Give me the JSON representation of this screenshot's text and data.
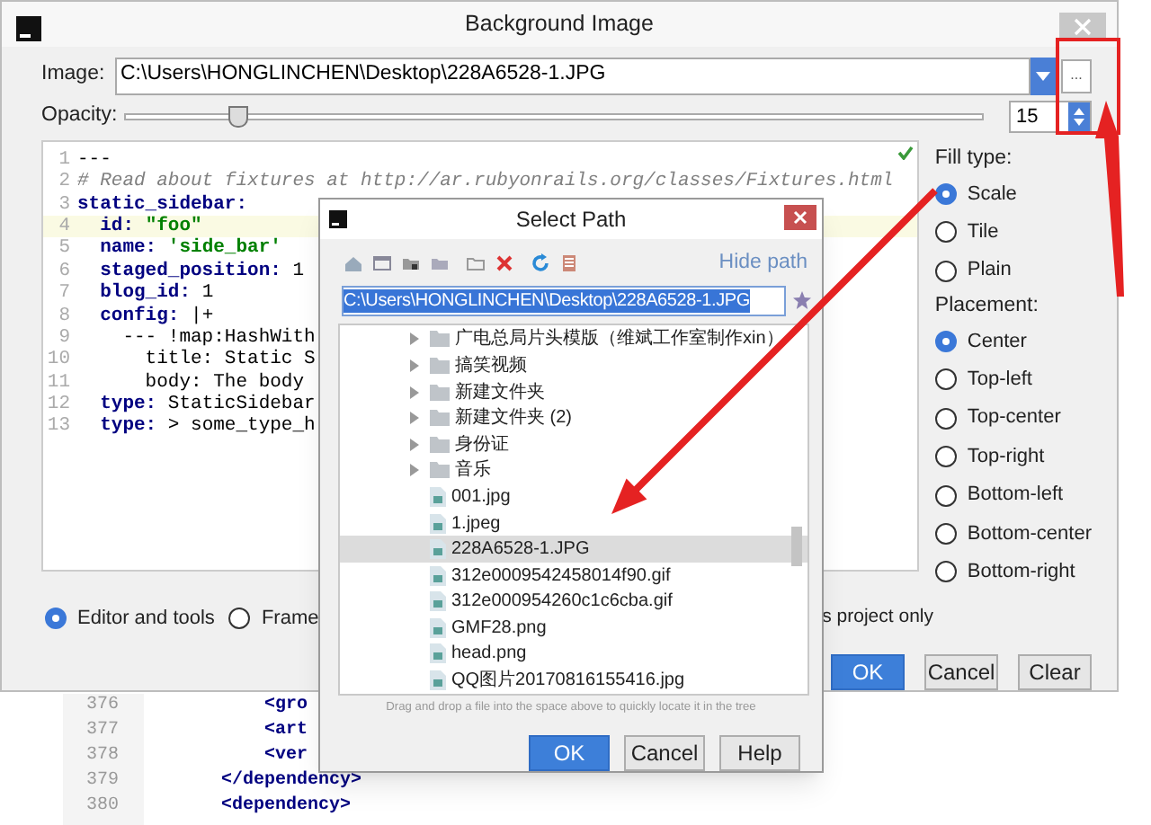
{
  "window": {
    "title": "Background Image"
  },
  "image_field": {
    "label": "Image:",
    "value": "C:\\Users\\HONGLINCHEN\\Desktop\\228A6528-1.JPG",
    "browse": "..."
  },
  "opacity": {
    "label": "Opacity:",
    "level": 0.13,
    "value": "15"
  },
  "preview_lines": [
    {
      "number": "1",
      "current": false,
      "tokens": [
        {
          "text": "---",
          "kind": "plain"
        }
      ]
    },
    {
      "number": "2",
      "current": false,
      "tokens": [
        {
          "text": "# Read about fixtures at http://ar.rubyonrails.org/classes/Fixtures.html",
          "kind": "comment"
        }
      ]
    },
    {
      "number": "3",
      "current": false,
      "tokens": [
        {
          "text": "static_sidebar:",
          "kind": "key"
        }
      ]
    },
    {
      "number": "4",
      "current": true,
      "tokens": [
        {
          "text": "  id:",
          "kind": "key"
        },
        {
          "text": " \"foo\"",
          "kind": "string"
        }
      ]
    },
    {
      "number": "5",
      "current": false,
      "tokens": [
        {
          "text": "  name:",
          "kind": "key"
        },
        {
          "text": " 'side_bar'",
          "kind": "string"
        }
      ]
    },
    {
      "number": "6",
      "current": false,
      "tokens": [
        {
          "text": "  staged_position:",
          "kind": "key"
        },
        {
          "text": " 1",
          "kind": "plain"
        }
      ]
    },
    {
      "number": "7",
      "current": false,
      "tokens": [
        {
          "text": "  blog_id:",
          "kind": "key"
        },
        {
          "text": " 1",
          "kind": "plain"
        }
      ]
    },
    {
      "number": "8",
      "current": false,
      "tokens": [
        {
          "text": "  config:",
          "kind": "key"
        },
        {
          "text": " |+",
          "kind": "plain"
        }
      ]
    },
    {
      "number": "9",
      "current": false,
      "tokens": [
        {
          "text": "    --- !map:HashWith",
          "kind": "plain"
        }
      ]
    },
    {
      "number": "10",
      "current": false,
      "tokens": [
        {
          "text": "      title: Static S",
          "kind": "plain"
        }
      ]
    },
    {
      "number": "11",
      "current": false,
      "tokens": [
        {
          "text": "      body: The body",
          "kind": "plain"
        }
      ]
    },
    {
      "number": "12",
      "current": false,
      "tokens": [
        {
          "text": "  type:",
          "kind": "key"
        },
        {
          "text": " StaticSidebar",
          "kind": "plain"
        }
      ]
    },
    {
      "number": "13",
      "current": false,
      "tokens": [
        {
          "text": "  type:",
          "kind": "key"
        },
        {
          "text": " > some_type_h",
          "kind": "plain"
        }
      ]
    }
  ],
  "fill_type": {
    "label": "Fill type:",
    "options": [
      {
        "label": "Scale",
        "selected": true
      },
      {
        "label": "Tile",
        "selected": false
      },
      {
        "label": "Plain",
        "selected": false
      }
    ]
  },
  "placement": {
    "label": "Placement:",
    "options": [
      {
        "label": "Center",
        "selected": true
      },
      {
        "label": "Top-left",
        "selected": false
      },
      {
        "label": "Top-center",
        "selected": false
      },
      {
        "label": "Top-right",
        "selected": false
      },
      {
        "label": "Bottom-left",
        "selected": false
      },
      {
        "label": "Bottom-center",
        "selected": false
      },
      {
        "label": "Bottom-right",
        "selected": false
      }
    ]
  },
  "target": [
    {
      "label": "Editor and tools",
      "selected": true
    },
    {
      "label": "Frame",
      "selected": false
    }
  ],
  "scope_note": "s project only",
  "buttons": [
    {
      "label": "OK",
      "kind": "primary"
    },
    {
      "label": "Cancel",
      "kind": "normal"
    },
    {
      "label": "Clear",
      "kind": "normal"
    }
  ],
  "select_path": {
    "title": "Select Path",
    "hide_path": "Hide path",
    "path": "C:\\Users\\HONGLINCHEN\\Desktop\\228A6528-1.JPG",
    "tree": [
      {
        "label": "广电总局片头模版（维斌工作室制作xin）",
        "kind": "folder",
        "expanded": false,
        "selected": false
      },
      {
        "label": "搞笑视频",
        "kind": "folder",
        "expanded": false,
        "selected": false
      },
      {
        "label": "新建文件夹",
        "kind": "folder",
        "expanded": false,
        "selected": false
      },
      {
        "label": "新建文件夹 (2)",
        "kind": "folder",
        "expanded": false,
        "selected": false
      },
      {
        "label": "身份证",
        "kind": "folder",
        "expanded": false,
        "selected": false
      },
      {
        "label": "音乐",
        "kind": "folder",
        "expanded": false,
        "selected": false
      },
      {
        "label": "001.jpg",
        "kind": "file",
        "selected": false
      },
      {
        "label": "1.jpeg",
        "kind": "file",
        "selected": false
      },
      {
        "label": "228A6528-1.JPG",
        "kind": "file",
        "selected": true
      },
      {
        "label": "312e0009542458014f90.gif",
        "kind": "file",
        "selected": false
      },
      {
        "label": "312e000954260c1c6cba.gif",
        "kind": "file",
        "selected": false
      },
      {
        "label": "GMF28.png",
        "kind": "file",
        "selected": false
      },
      {
        "label": "head.png",
        "kind": "file",
        "selected": false
      },
      {
        "label": "QQ图片20170816155416.jpg",
        "kind": "file",
        "selected": false
      }
    ],
    "hint": "Drag and drop a file into the space above to quickly locate it in the tree",
    "buttons": [
      {
        "label": "OK",
        "kind": "primary"
      },
      {
        "label": "Cancel",
        "kind": "normal"
      },
      {
        "label": "Help",
        "kind": "normal"
      }
    ]
  },
  "background_editor": {
    "lines": [
      {
        "number": "376",
        "tokens": [
          {
            "text": "    <gro",
            "kind": "tag"
          }
        ]
      },
      {
        "number": "377",
        "tokens": [
          {
            "text": "    <art",
            "kind": "tag"
          }
        ]
      },
      {
        "number": "378",
        "tokens": [
          {
            "text": "    <ver",
            "kind": "tag"
          }
        ]
      },
      {
        "number": "379",
        "tokens": [
          {
            "text": "</dependency>",
            "kind": "tag"
          }
        ]
      },
      {
        "number": "380",
        "tokens": [
          {
            "text": "<dependency>",
            "kind": "tag"
          }
        ]
      }
    ]
  }
}
